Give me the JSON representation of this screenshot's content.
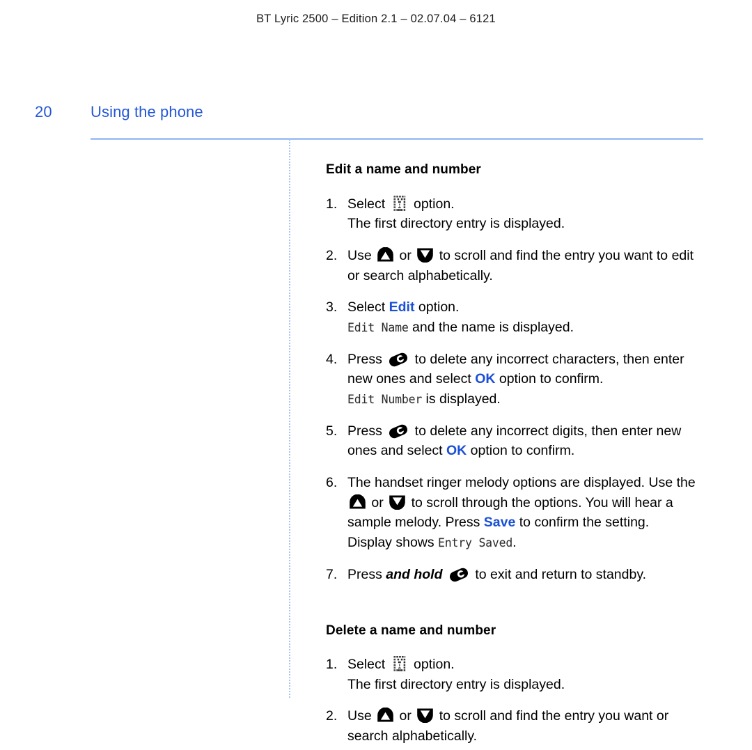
{
  "header": {
    "running_head": "BT Lyric 2500 – Edition 2.1 – 02.07.04 – 6121"
  },
  "page": {
    "folio": "20",
    "section_title": "Using the phone"
  },
  "colors": {
    "accent_blue": "#1a4fd6",
    "title_blue": "#2457d6",
    "rule_blue": "#a8c4f5"
  },
  "sections": [
    {
      "heading": "Edit a name and number",
      "steps": [
        {
          "num": "1.",
          "parts": [
            {
              "t": "text",
              "v": "Select "
            },
            {
              "t": "icon",
              "v": "phonebook-lcd-icon"
            },
            {
              "t": "text",
              "v": " option."
            },
            {
              "t": "break"
            },
            {
              "t": "text",
              "v": "The first directory entry is displayed."
            }
          ]
        },
        {
          "num": "2.",
          "parts": [
            {
              "t": "text",
              "v": "Use "
            },
            {
              "t": "icon",
              "v": "scroll-up-button-icon"
            },
            {
              "t": "text",
              "v": " or "
            },
            {
              "t": "icon",
              "v": "scroll-down-button-icon"
            },
            {
              "t": "text",
              "v": " to scroll and find the entry you want to edit or search alphabetically."
            }
          ]
        },
        {
          "num": "3.",
          "parts": [
            {
              "t": "text",
              "v": "Select "
            },
            {
              "t": "blue",
              "v": "Edit"
            },
            {
              "t": "text",
              "v": " option."
            },
            {
              "t": "break"
            },
            {
              "t": "lcd",
              "v": "Edit Name"
            },
            {
              "t": "text",
              "v": " and the name is displayed."
            }
          ]
        },
        {
          "num": "4.",
          "parts": [
            {
              "t": "text",
              "v": "Press "
            },
            {
              "t": "icon",
              "v": "end-call-key-icon"
            },
            {
              "t": "text",
              "v": " to delete any incorrect characters, then enter new ones and select "
            },
            {
              "t": "blue",
              "v": "OK"
            },
            {
              "t": "text",
              "v": " option to confirm."
            },
            {
              "t": "break"
            },
            {
              "t": "lcd",
              "v": "Edit Number"
            },
            {
              "t": "text",
              "v": " is displayed."
            }
          ]
        },
        {
          "num": "5.",
          "parts": [
            {
              "t": "text",
              "v": "Press "
            },
            {
              "t": "icon",
              "v": "end-call-key-icon"
            },
            {
              "t": "text",
              "v": " to delete any incorrect digits, then enter new ones and select "
            },
            {
              "t": "blue",
              "v": "OK"
            },
            {
              "t": "text",
              "v": " option to confirm."
            }
          ]
        },
        {
          "num": "6.",
          "parts": [
            {
              "t": "text",
              "v": "The handset ringer melody options are displayed. Use the "
            },
            {
              "t": "icon",
              "v": "scroll-up-button-icon"
            },
            {
              "t": "text",
              "v": " or "
            },
            {
              "t": "icon",
              "v": "scroll-down-button-icon"
            },
            {
              "t": "text",
              "v": " to scroll through the options. You will hear a sample melody. Press "
            },
            {
              "t": "blue",
              "v": "Save"
            },
            {
              "t": "text",
              "v": " to confirm the setting."
            },
            {
              "t": "break"
            },
            {
              "t": "text",
              "v": "Display shows "
            },
            {
              "t": "lcd",
              "v": "Entry Saved"
            },
            {
              "t": "text",
              "v": "."
            }
          ]
        },
        {
          "num": "7.",
          "parts": [
            {
              "t": "text",
              "v": "Press "
            },
            {
              "t": "bolditalic",
              "v": "and hold"
            },
            {
              "t": "text",
              "v": " "
            },
            {
              "t": "icon",
              "v": "end-call-key-icon"
            },
            {
              "t": "text",
              "v": " to exit and return to standby."
            }
          ]
        }
      ]
    },
    {
      "heading": "Delete a name and number",
      "steps": [
        {
          "num": "1.",
          "parts": [
            {
              "t": "text",
              "v": "Select "
            },
            {
              "t": "icon",
              "v": "phonebook-lcd-icon"
            },
            {
              "t": "text",
              "v": " option."
            },
            {
              "t": "break"
            },
            {
              "t": "text",
              "v": "The first directory entry is displayed."
            }
          ]
        },
        {
          "num": "2.",
          "parts": [
            {
              "t": "text",
              "v": "Use "
            },
            {
              "t": "icon",
              "v": "scroll-up-button-icon"
            },
            {
              "t": "text",
              "v": " or "
            },
            {
              "t": "icon",
              "v": "scroll-down-button-icon"
            },
            {
              "t": "text",
              "v": " to scroll and find the entry you want or search alphabetically."
            }
          ]
        }
      ]
    }
  ]
}
